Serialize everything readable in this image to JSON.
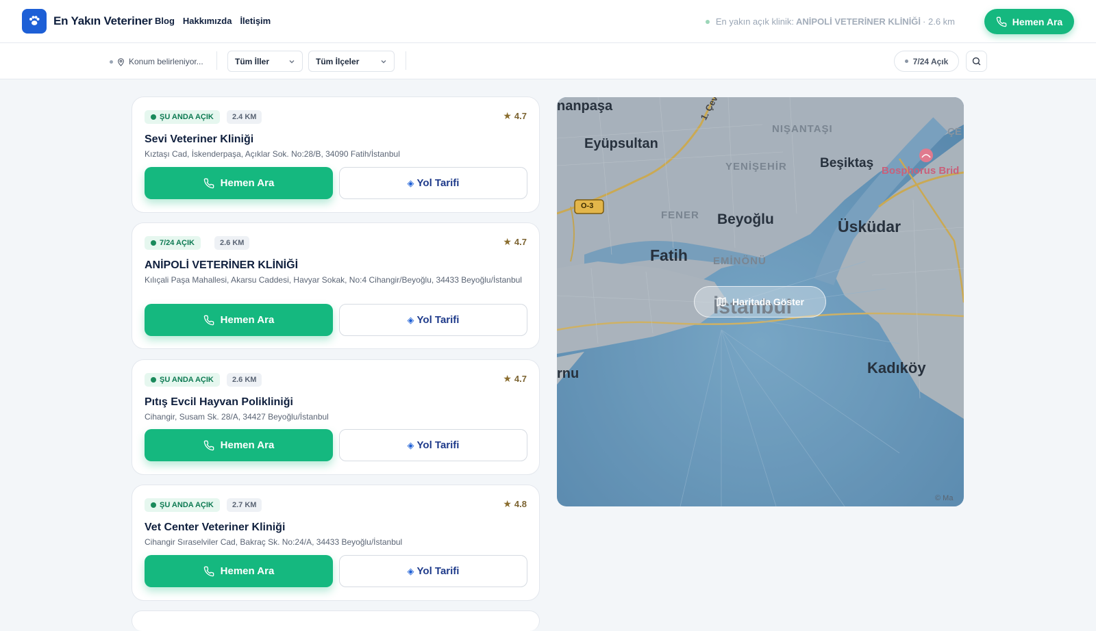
{
  "header": {
    "brand": "En Yakın Veteriner",
    "nav": [
      "Blog",
      "Hakkımızda",
      "İletişim"
    ],
    "nearest_prefix": "En yakın açık klinik:",
    "nearest_name": "ANİPOLİ VETERİNER KLİNİĞİ",
    "nearest_dist": "· 2.6 km",
    "call_label": "Hemen Ara"
  },
  "filters": {
    "location": "Konum belirleniyor...",
    "province": "Tüm İller",
    "district": "Tüm İlçeler",
    "open247": "7/24 Açık"
  },
  "clinics": [
    {
      "status": "ŞU ANDA AÇIK",
      "distance": "2.4 KM",
      "rating": "4.7",
      "name": "Sevi Veteriner Kliniği",
      "address": "Kıztaşı Cad, İskenderpaşa, Açıklar Sok. No:28/B, 34090 Fatih/İstanbul"
    },
    {
      "status": "7/24 AÇIK",
      "distance": "2.6 KM",
      "rating": "4.7",
      "name": "ANİPOLİ VETERİNER KLİNİĞİ",
      "address": "Kılıçali Paşa Mahallesi, Akarsu Caddesi, Havyar Sokak, No:4 Cihangir/Beyoğlu, 34433 Beyoğlu/İstanbul"
    },
    {
      "status": "ŞU ANDA AÇIK",
      "distance": "2.6 KM",
      "rating": "4.7",
      "name": "Pıtış Evcil Hayvan Polikliniği",
      "address": "Cihangir, Susam Sk. 28/A, 34427 Beyoğlu/İstanbul"
    },
    {
      "status": "ŞU ANDA AÇIK",
      "distance": "2.7 KM",
      "rating": "4.8",
      "name": "Vet Center Veteriner Kliniği",
      "address": "Cihangir Sıraselviler Cad, Bakraç Sk. No:24/A, 34433 Beyoğlu/İstanbul"
    }
  ],
  "card_actions": {
    "call": "Hemen Ara",
    "directions": "Yol Tarifi"
  },
  "map": {
    "button": "Haritada Göster",
    "labels": {
      "eyupsultan": "Eyüpsultan",
      "nisantasi": "NIŞANTAŞI",
      "yenisehir": "YENİŞEHİR",
      "besiktas": "Beşiktaş",
      "bosphorus": "Bosphorus Brid",
      "fener": "FENER",
      "beyoglu": "Beyoğlu",
      "uskudar": "Üsküdar",
      "fatih": "Fatih",
      "eminonu": "EMİNÖNÜ",
      "istanbul": "İstanbul",
      "kadikoy": "Kadıköy",
      "nanpasa": "nanpaşa",
      "rnu": "rnu",
      "cevre": "1. Çev",
      "road": "O-3",
      "ce": "ÇE",
      "attribution": "© Ma"
    }
  }
}
